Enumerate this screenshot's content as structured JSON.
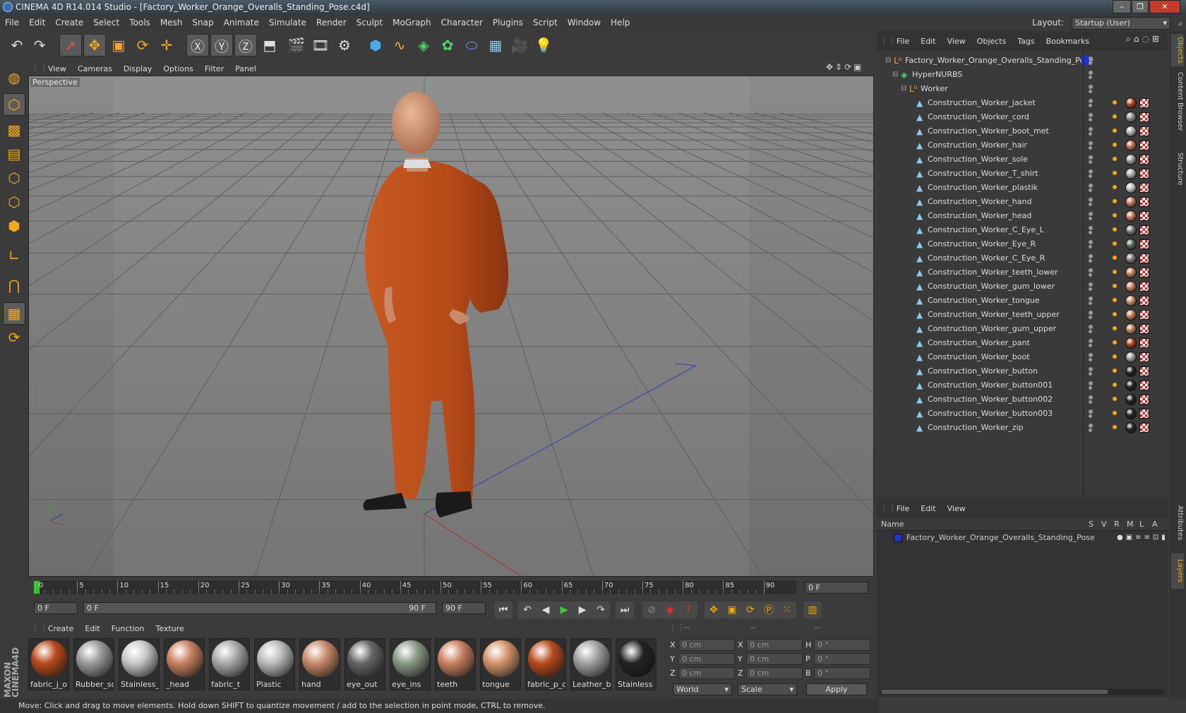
{
  "app": {
    "title": "CINEMA 4D R14.014 Studio - [Factory_Worker_Orange_Overalls_Standing_Pose.c4d]",
    "layout_label": "Layout:",
    "layout_value": "Startup (User)"
  },
  "menu": [
    "File",
    "Edit",
    "Create",
    "Select",
    "Tools",
    "Mesh",
    "Snap",
    "Animate",
    "Simulate",
    "Render",
    "Sculpt",
    "MoGraph",
    "Character",
    "Plugins",
    "Script",
    "Window",
    "Help"
  ],
  "toolbar_icons": [
    "undo-icon",
    "redo-icon",
    "live-select-icon",
    "move-icon",
    "scale-icon",
    "rotate-icon",
    "recent-tool-icon",
    "x-axis-icon",
    "y-axis-icon",
    "z-axis-icon",
    "coordinate-system-icon",
    "render-view-icon",
    "render-picture-viewer-icon",
    "render-settings-icon",
    "cube-primitive-icon",
    "spline-icon",
    "nurbs-icon",
    "array-icon",
    "deformer-icon",
    "floor-icon",
    "camera-icon",
    "light-icon"
  ],
  "viewport": {
    "menu": [
      "View",
      "Cameras",
      "Display",
      "Options",
      "Filter",
      "Panel"
    ],
    "label": "Perspective"
  },
  "timeline": {
    "ticks": [
      "0",
      "5",
      "10",
      "15",
      "20",
      "25",
      "30",
      "35",
      "40",
      "45",
      "50",
      "55",
      "60",
      "65",
      "70",
      "75",
      "80",
      "85",
      "90"
    ],
    "frame_field": "0 F",
    "start_field": "0 F",
    "range_start": "0 F",
    "range_end": "90 F",
    "end_field": "90 F"
  },
  "materials": {
    "menu": [
      "Create",
      "Edit",
      "Function",
      "Texture"
    ],
    "items": [
      {
        "label": "fabric_j_o",
        "color": "#b84a1c"
      },
      {
        "label": "Rubber_so",
        "color": "#9a9a9a"
      },
      {
        "label": "Stainless_",
        "color": "#c8c8c8"
      },
      {
        "label": "_head",
        "color": "#c98060"
      },
      {
        "label": "fabric_t",
        "color": "#aaaaaa"
      },
      {
        "label": "Plastic",
        "color": "#bbbbbb"
      },
      {
        "label": "hand",
        "color": "#c98a6a"
      },
      {
        "label": "eye_out",
        "color": "#666666"
      },
      {
        "label": "eye_ins",
        "color": "#8a9a88"
      },
      {
        "label": "teeth",
        "color": "#c98060"
      },
      {
        "label": "tongue",
        "color": "#d4956a"
      },
      {
        "label": "fabric_p_o",
        "color": "#b84a1c"
      },
      {
        "label": "Leather_bt",
        "color": "#a0a0a0"
      },
      {
        "label": "Stainless",
        "color": "#222222"
      }
    ]
  },
  "coords": {
    "header": [
      "--",
      "--",
      "--"
    ],
    "rows": [
      {
        "a": "X",
        "av": "0 cm",
        "b": "X",
        "bv": "0 cm",
        "c": "H",
        "cv": "0 °"
      },
      {
        "a": "Y",
        "av": "0 cm",
        "b": "Y",
        "bv": "0 cm",
        "c": "P",
        "cv": "0 °"
      },
      {
        "a": "Z",
        "av": "0 cm",
        "b": "Z",
        "bv": "0 cm",
        "c": "B",
        "cv": "0 °"
      }
    ],
    "mode": "World",
    "scale": "Scale",
    "apply": "Apply"
  },
  "objects": {
    "menu": [
      "File",
      "Edit",
      "View",
      "Objects",
      "Tags",
      "Bookmarks"
    ],
    "root": "Factory_Worker_Orange_Overalls_Standing_Pose",
    "hypernurbs": "HyperNURBS",
    "group": "Worker",
    "items": [
      {
        "name": "Construction_Worker_jacket",
        "tag": "#a84418"
      },
      {
        "name": "Construction_Worker_cord",
        "tag": "#888888"
      },
      {
        "name": "Construction_Worker_boot_met",
        "tag": "#aaaaaa"
      },
      {
        "name": "Construction_Worker_hair",
        "tag": "#b86a4a"
      },
      {
        "name": "Construction_Worker_sole",
        "tag": "#999999"
      },
      {
        "name": "Construction_Worker_T_shirt",
        "tag": "#aaaaaa"
      },
      {
        "name": "Construction_Worker_plastik",
        "tag": "#bbbbbb"
      },
      {
        "name": "Construction_Worker_hand",
        "tag": "#c07a5a"
      },
      {
        "name": "Construction_Worker_head",
        "tag": "#c07a5a"
      },
      {
        "name": "Construction_Worker_C_Eye_L",
        "tag": "#777777"
      },
      {
        "name": "Construction_Worker_Eye_R",
        "tag": "#556655"
      },
      {
        "name": "Construction_Worker_C_Eye_R",
        "tag": "#777777"
      },
      {
        "name": "Construction_Worker_teeth_lower",
        "tag": "#c07a5a"
      },
      {
        "name": "Construction_Worker_gum_lower",
        "tag": "#c07a5a"
      },
      {
        "name": "Construction_Worker_tongue",
        "tag": "#c48a6a"
      },
      {
        "name": "Construction_Worker_teeth_upper",
        "tag": "#c07a5a"
      },
      {
        "name": "Construction_Worker_gum_upper",
        "tag": "#c07a5a"
      },
      {
        "name": "Construction_Worker_pant",
        "tag": "#a84418"
      },
      {
        "name": "Construction_Worker_boot",
        "tag": "#999999"
      },
      {
        "name": "Construction_Worker_button",
        "tag": "#222222"
      },
      {
        "name": "Construction_Worker_button001",
        "tag": "#222222"
      },
      {
        "name": "Construction_Worker_button002",
        "tag": "#222222"
      },
      {
        "name": "Construction_Worker_button003",
        "tag": "#222222"
      },
      {
        "name": "Construction_Worker_zip",
        "tag": "#222222"
      }
    ]
  },
  "layers": {
    "menu": [
      "File",
      "Edit",
      "View"
    ],
    "headers": {
      "name": "Name",
      "cols": [
        "S",
        "V",
        "R",
        "M",
        "L",
        "A"
      ]
    },
    "row": "Factory_Worker_Orange_Overalls_Standing_Pose"
  },
  "right_tabs": [
    "Objects",
    "Content Browser",
    "Structure",
    "Attributes",
    "Layers"
  ],
  "status": "Move: Click and drag to move elements. Hold down SHIFT to quantize movement / add to the selection in point mode, CTRL to remove.",
  "colors": {
    "accent": "#2233cc",
    "orange": "#b84a1c",
    "bg": "#3b3b3b"
  }
}
